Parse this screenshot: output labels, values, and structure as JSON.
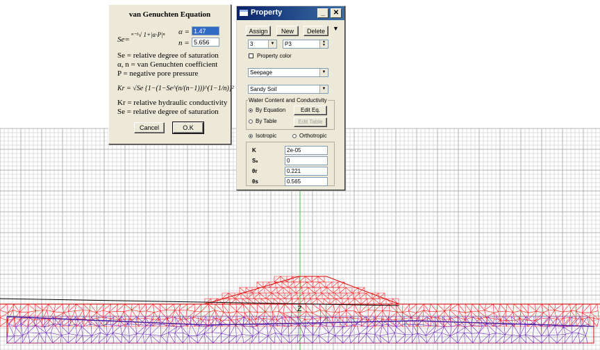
{
  "vg_dialog": {
    "title": "van Genuchten Equation",
    "se_eq": "Se=",
    "se_eq_rhs": "ⁿ⁻¹√ 1+|α·P|ⁿ",
    "alpha_label": "α =",
    "alpha_value": "1.47",
    "n_label": "n =",
    "n_value": "5.656",
    "def_se": "Se = relative degree of saturation",
    "def_an": "α, n = van Genuchten coefficient",
    "def_p": "P = negative pore pressure",
    "kr_eq": "Kr = √Se {1−(1−Se^(n/(n−1)))^(1−1/n)}²",
    "def_kr": "Kr = relative hydraulic conductivity",
    "def_se2": "Se = relative degree of saturation",
    "cancel": "Cancel",
    "ok": "O.K"
  },
  "property_dialog": {
    "title": "Property",
    "assign": "Assign",
    "new": "New",
    "delete": "Delete",
    "id_value": "3",
    "name_value": "P3",
    "property_color": "Property color",
    "analysis": "Seepage",
    "material": "Sandy Soil",
    "group_title": "Water Content and Conductivity",
    "by_equation": "By Equation",
    "edit_eq": "Edit Eq.",
    "by_table": "By Table",
    "edit_table": "Edit Table",
    "isotropic": "Isotropic",
    "orthotropic": "Orthotropic",
    "k_label": "K",
    "k_value": "2e-05",
    "ss_label": "Sₛ",
    "ss_value": "0",
    "thr_label": "θr",
    "thr_value": "0.221",
    "ths_label": "θs",
    "ths_value": "0.565"
  },
  "canvas": {
    "axis_label": "Z",
    "grid_color": "#c0c0c0",
    "mesh_red": "#ff2020",
    "mesh_purple": "#7030c0",
    "axis_green": "#40c040"
  }
}
